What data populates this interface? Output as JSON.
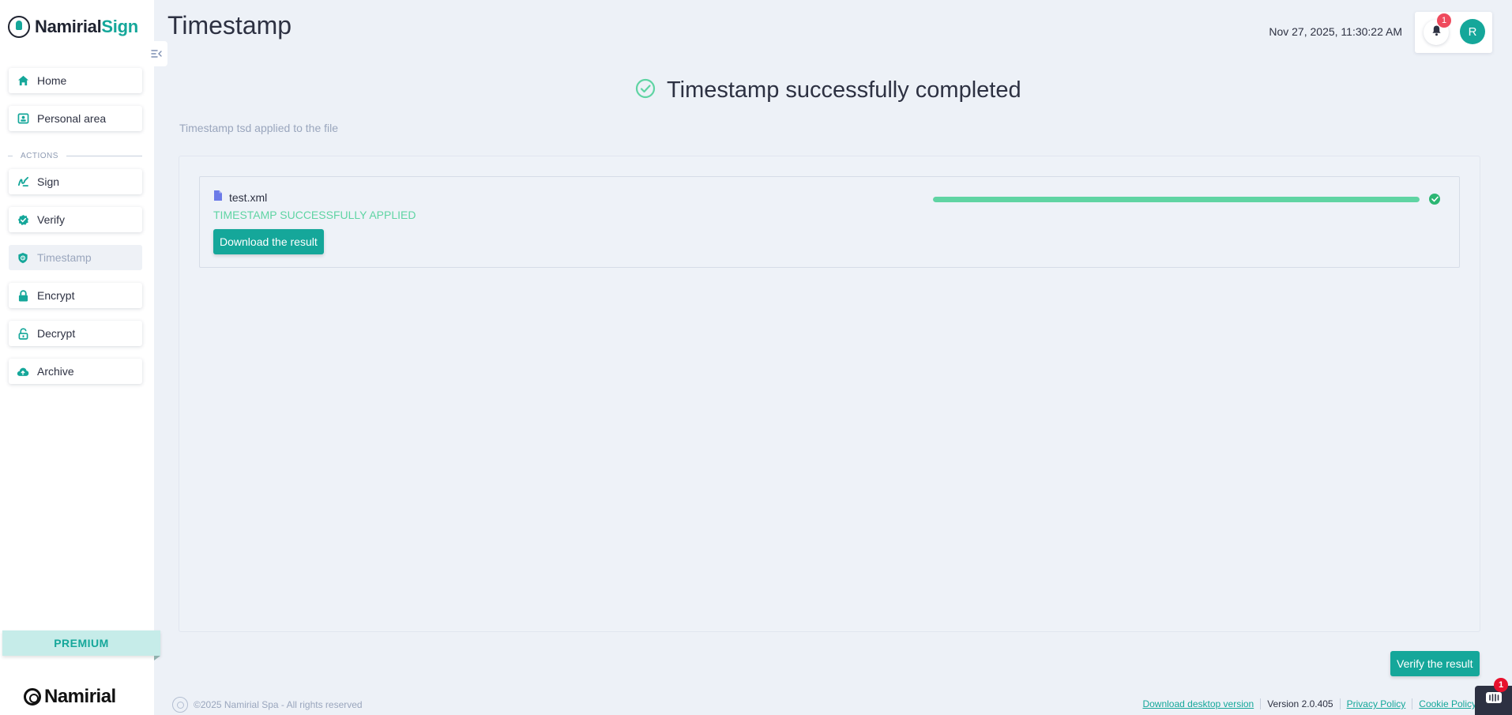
{
  "sidebar": {
    "brand_main": "Namirial",
    "brand_accent": "Sign",
    "items": [
      {
        "label": "Home",
        "icon": "home-icon"
      },
      {
        "label": "Personal area",
        "icon": "contact-card-icon"
      },
      {
        "label": "Sign",
        "icon": "signature-icon"
      },
      {
        "label": "Verify",
        "icon": "verified-badge-icon"
      },
      {
        "label": "Timestamp",
        "icon": "shield-clock-icon",
        "active": true
      },
      {
        "label": "Encrypt",
        "icon": "lock-icon"
      },
      {
        "label": "Decrypt",
        "icon": "unlock-icon"
      },
      {
        "label": "Archive",
        "icon": "cloud-upload-icon"
      }
    ],
    "section_label": "ACTIONS",
    "premium_label": "PREMIUM",
    "footer_brand": "Namirial"
  },
  "header": {
    "title": "Timestamp",
    "datetime": "Nov 27, 2025, 11:30:22 AM",
    "notification_count": "1",
    "avatar_initial": "R"
  },
  "main": {
    "heading": "Timestamp successfully completed",
    "subtitle": "Timestamp tsd applied to the file",
    "file": {
      "name": "test.xml",
      "status": "TIMESTAMP SUCCESSFULLY APPLIED",
      "progress": 1.0,
      "download_label": "Download the result"
    },
    "verify_label": "Verify the result"
  },
  "footer": {
    "copyright": "©2025 Namirial Spa - All rights reserved",
    "download_desktop": "Download desktop version",
    "version": "Version 2.0.405",
    "privacy": "Privacy Policy",
    "cookie": "Cookie Policy",
    "chat_badge": "1"
  },
  "colors": {
    "accent": "#15a79a",
    "success": "#5fd4a3",
    "badge": "#ef4a5d",
    "background": "#edf1f7"
  }
}
